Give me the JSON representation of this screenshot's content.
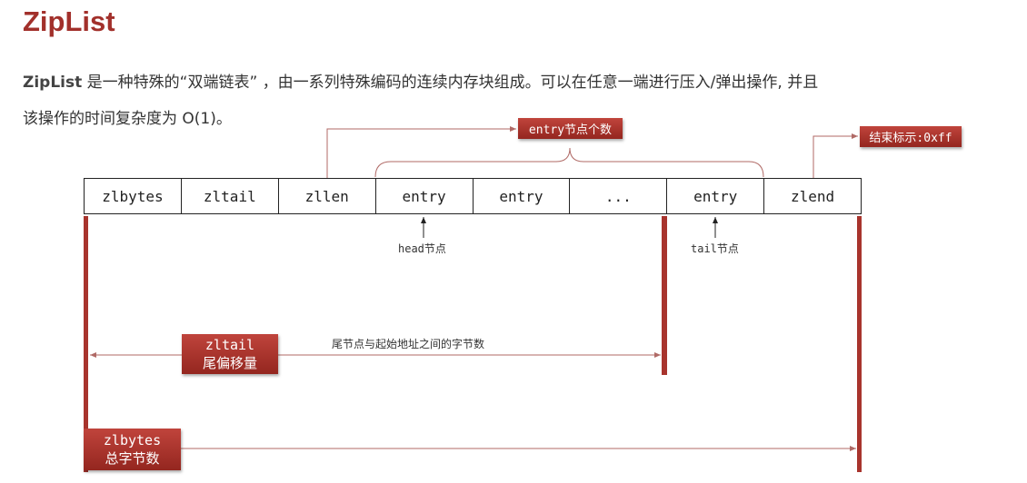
{
  "title": "ZipList",
  "description": {
    "bold": "ZipList",
    "line1": " 是一种特殊的“双端链表” ，由一系列特殊编码的连续内存块组成。可以在任意一端进行压入/弹出操作, 并且",
    "line2": "该操作的时间复杂度为 O(1)。"
  },
  "cells": [
    "zlbytes",
    "zltail",
    "zllen",
    "entry",
    "entry",
    "...",
    "entry",
    "zlend"
  ],
  "entry_count_label": "entry节点个数",
  "end_marker_label": "结束标示:0xff",
  "head_label": "head节点",
  "tail_label": "tail节点",
  "zltail_tag": {
    "line1": "zltail",
    "line2": "尾偏移量"
  },
  "zltail_desc": "尾节点与起始地址之间的字节数",
  "zlbytes_tag": {
    "line1": "zlbytes",
    "line2": "总字节数"
  },
  "colors": {
    "accent": "#a2302b",
    "line": "#b06a66"
  }
}
